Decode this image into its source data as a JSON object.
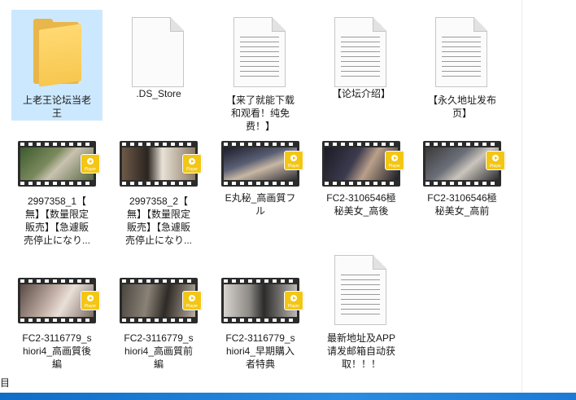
{
  "files": [
    {
      "type": "folder",
      "label": "上老王论坛当老\n王",
      "selected": true,
      "icon": "folder-icon"
    },
    {
      "type": "blank",
      "label": ".DS_Store",
      "icon": "blank-file-icon"
    },
    {
      "type": "document",
      "label": "【来了就能下载\n和观看！纯免\n费！】",
      "icon": "document-icon"
    },
    {
      "type": "document",
      "label": "【论坛介绍】",
      "icon": "document-icon"
    },
    {
      "type": "document",
      "label": "【永久地址发布\n页】",
      "icon": "document-icon"
    },
    {
      "type": "video",
      "label": "2997358_1【\n無】【数量限定\n販売】【急遽販\n売停止になり...",
      "icon": "video-thumbnail-icon"
    },
    {
      "type": "video",
      "label": "2997358_2【\n無】【数量限定\n販売】【急遽販\n売停止になり...",
      "icon": "video-thumbnail-icon"
    },
    {
      "type": "video",
      "label": "E丸秘_高画質フ\nル",
      "icon": "video-thumbnail-icon"
    },
    {
      "type": "video",
      "label": "FC2-3106546極\n秘美女_高後",
      "icon": "video-thumbnail-icon"
    },
    {
      "type": "video",
      "label": "FC2-3106546極\n秘美女_高前",
      "icon": "video-thumbnail-icon"
    },
    {
      "type": "video",
      "label": "FC2-3116779_s\nhiori4_高画質後\n編",
      "icon": "video-thumbnail-icon"
    },
    {
      "type": "video",
      "label": "FC2-3116779_s\nhiori4_高画質前\n編",
      "icon": "video-thumbnail-icon"
    },
    {
      "type": "video",
      "label": "FC2-3116779_s\nhiori4_早期購入\n者特典",
      "icon": "video-thumbnail-icon"
    },
    {
      "type": "document",
      "label": "最新地址及APP\n请发邮箱自动获\n取！！！",
      "icon": "document-icon"
    }
  ],
  "player_badge_text": "Player",
  "statusbar": {
    "left_text": "目"
  },
  "colors": {
    "selection": "#cce8ff",
    "folder": "#f7c74f",
    "badge": "#f3c614",
    "taskbar": "#1c7ad6"
  }
}
